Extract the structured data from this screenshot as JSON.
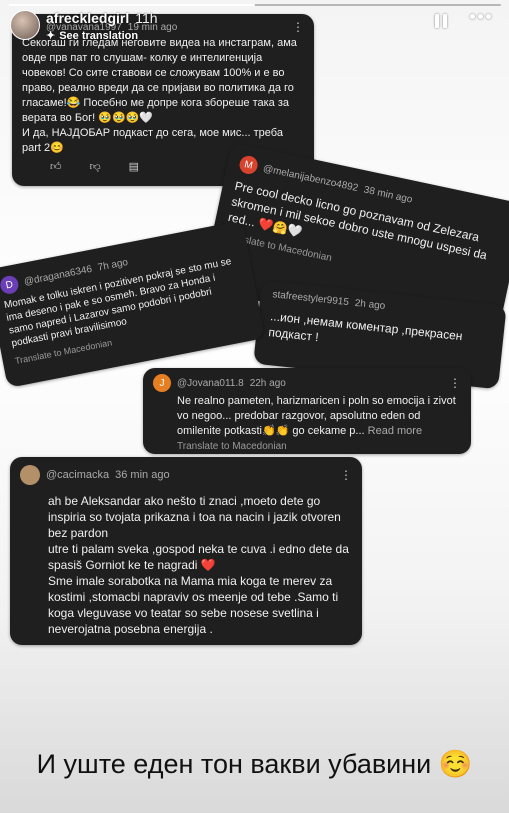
{
  "story": {
    "username": "afreckledgirl",
    "time": "11h",
    "see_translation": "See translation",
    "progress": 0.5,
    "caption": "И уште еден тон вакви убавини ☺️"
  },
  "comments": [
    {
      "user": "@vanavana1997",
      "time": "19 min ago",
      "text": "Секогаш ги гледам неговите видеа на инстаграм, ама овде прв пат го слушам- колку е интелигенција човеков! Со сите ставови се сложувам 100% и е во право, реално вреди да се пријави во политика да го гласаме!😂 Посебно ме допре кога збореше така за верата во Бог! 🥹🥹🥹🤍\nИ да, НАЈДОБАР подкаст до сега, мое мис... треба part 2😊",
      "avatar_letter": "",
      "avatar_color": "#555555",
      "translate": ""
    },
    {
      "user": "@melanijabenzo4892",
      "time": "38 min ago",
      "text": "Pre cool decko licno go poznavam od Zelezara skromen i mil sekoe dobro uste mnogu uspesi da red... ❤️🤗🤍",
      "avatar_letter": "M",
      "avatar_color": "#d8432e",
      "translate": "Translate to Macedonian"
    },
    {
      "user": "@dragana6346",
      "time": "7h ago",
      "text": "Momak e tolku iskren i pozitiven pokraj se sto mu se ima deseno i pak e so osmeh. Bravo za Honda i samo napred i Lazarov samo podobri i podobri podkasti pravi bravilisimoo",
      "avatar_letter": "D",
      "avatar_color": "#6a3fb5",
      "translate": "Translate to Macedonian"
    },
    {
      "user": "stafreestyler9915",
      "time": "2h ago",
      "text": "...ион ,немам коментар ,прекрасен подкаст !",
      "avatar_letter": "",
      "avatar_color": "#555555",
      "translate": ""
    },
    {
      "user": "@Jovana011.8",
      "time": "22h ago",
      "text": "Ne realno pameten, harizmaricen i poln so emocija i zivot vo negoo... predobar razgovor, apsolutno eden od omilenite potkasti👏👏 go cekame p...",
      "read_more": "Read more",
      "avatar_letter": "J",
      "avatar_color": "#e67e22",
      "translate": "Translate to Macedonian"
    },
    {
      "user": "@cacimacka",
      "time": "36 min ago",
      "text": "ah be Aleksandar ako nešto ti znaci ,moeto dete go inspiria so tvojata prikazna i toa na nacin i jazik otvoren bez pardon\nutre ti palam sveka ,gospod neka te cuva .i edno dete da spasiš Gorniot ke te nagradi ❤️\nSme imale sorabotka na Mama mia koga te merev za kostimi ,stomacbi napraviv os meenje od tebe .Samo ti koga vleguvase vo teatar so sebe nosese svetlina i neverojatna posebna energija .",
      "avatar_letter": "",
      "avatar_color": "#b49068",
      "translate": ""
    }
  ],
  "icons": {
    "like": "thumbs-up-icon",
    "dislike": "thumbs-down-icon",
    "reply": "reply-icon",
    "kebab": "kebab-icon"
  }
}
